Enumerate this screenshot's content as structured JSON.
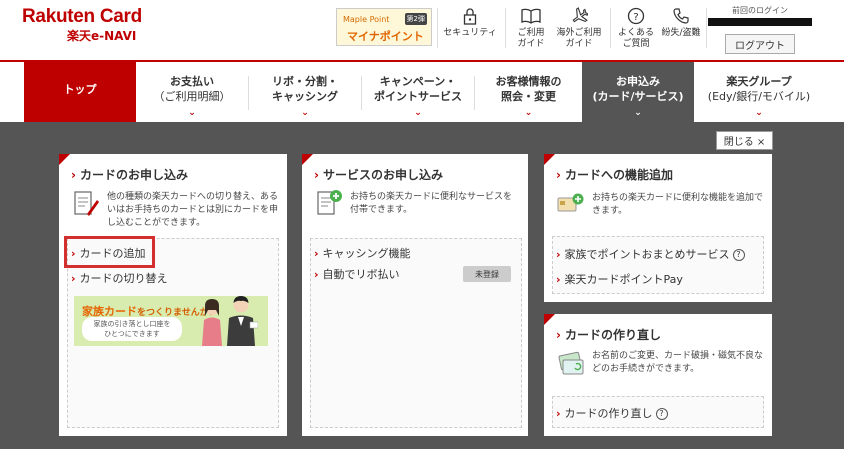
{
  "header": {
    "logo_main": "Rakuten Card",
    "logo_sub": "楽天e-NAVI",
    "banner": {
      "top": "Maple Point",
      "main": "マイナポイント",
      "badge": "第2弾"
    },
    "icons": [
      {
        "label": "セキュリティ",
        "icon": "lock-icon"
      },
      {
        "label": "ご利用\nガイド",
        "icon": "book-icon"
      },
      {
        "label": "海外ご利用\nガイド",
        "icon": "airplane-icon"
      },
      {
        "label": "よくある\nご質問",
        "icon": "question-icon"
      },
      {
        "label": "紛失/盗難",
        "icon": "phone-icon"
      }
    ],
    "login_label": "前回のログイン",
    "logout_label": "ログアウト"
  },
  "nav": [
    {
      "main": "トップ",
      "sub": ""
    },
    {
      "main": "お支払い",
      "sub": "（ご利用明細）"
    },
    {
      "main": "リボ・分割・",
      "sub": "キャッシング"
    },
    {
      "main": "キャンペーン・",
      "sub": "ポイントサービス"
    },
    {
      "main": "お客様情報の",
      "sub": "照会・変更"
    },
    {
      "main": "お申込み",
      "sub": "(カード/サービス)"
    },
    {
      "main": "楽天グループ",
      "sub": "(Edy/銀行/モバイル)"
    }
  ],
  "close_label": "閉じる ×",
  "cards": {
    "card_apply": {
      "title": "カードのお申し込み",
      "desc": "他の種類の楽天カードへの切り替え、あるいはお手持ちのカードとは別にカードを申し込むことができます。",
      "links": [
        "カードの追加",
        "カードの切り替え"
      ],
      "banner": {
        "title_big": "家族カード",
        "title_rest": "をつくりませんか？",
        "sub1": "家族の引き落とし口座を",
        "sub2": "ひとつにできます"
      }
    },
    "service_apply": {
      "title": "サービスのお申し込み",
      "desc": "お持ちの楽天カードに便利なサービスを付帯できます。",
      "links": [
        "キャッシング機能",
        "自動でリボ払い"
      ],
      "badge": "未登録"
    },
    "feature_add": {
      "title": "カードへの機能追加",
      "desc": "お持ちの楽天カードに便利な機能を追加できます。",
      "links": [
        "家族でポイントおまとめサービス",
        "楽天カードポイントPay"
      ]
    },
    "remake": {
      "title": "カードの作り直し",
      "desc": "お名前のご変更、カード破損・磁気不良などのお手続きができます。",
      "links": [
        "カードの作り直し"
      ]
    }
  },
  "colors": {
    "brand_red": "#bf0000",
    "overlay": "#555555",
    "highlight": "#d32f2f"
  }
}
